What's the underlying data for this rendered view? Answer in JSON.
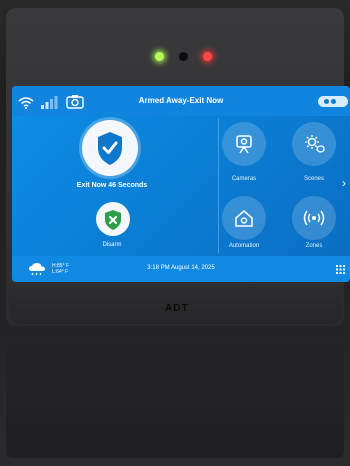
{
  "status": {
    "title": "Armed Away-Exit Now",
    "countdown_text": "Exit Now 46 Seconds",
    "disarm_label": "Disarm"
  },
  "tiles": [
    {
      "label": "Cameras",
      "icon": "camera-icon"
    },
    {
      "label": "Scenes",
      "icon": "scenes-icon"
    },
    {
      "label": "Automation",
      "icon": "automation-icon"
    },
    {
      "label": "Zones",
      "icon": "zones-icon"
    }
  ],
  "bottom": {
    "temp_high": "H:85° F",
    "temp_low": "L:64° F",
    "datetime": "3:18 PM August 14, 2025"
  },
  "device": {
    "brand": "ADT"
  },
  "colors": {
    "screen": "#0b7fd6",
    "led_green": "#b6ff5b",
    "led_red": "#ff4a4a"
  }
}
